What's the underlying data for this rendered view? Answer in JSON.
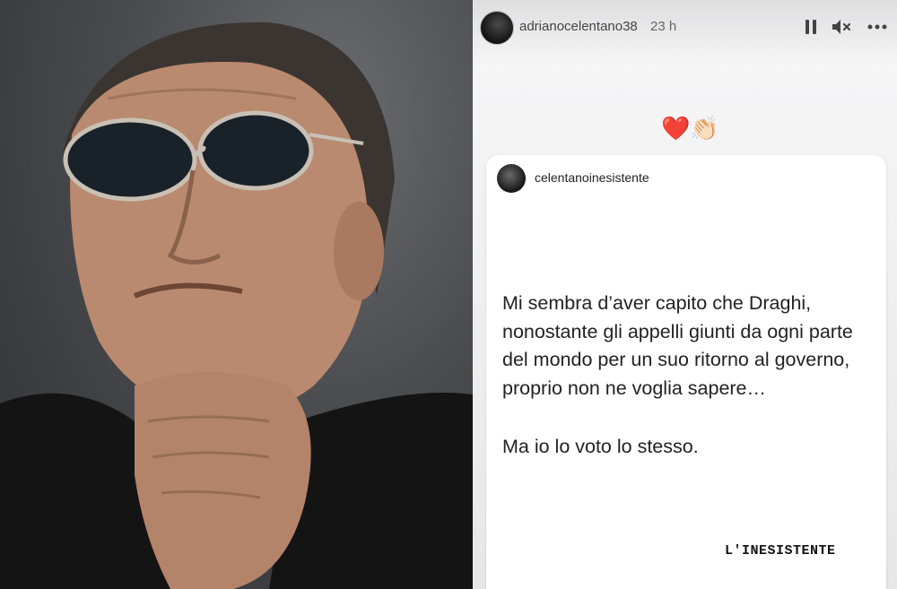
{
  "story": {
    "username": "adrianocelentano38",
    "time": "23 h",
    "controls": {
      "pause_icon": "pause-icon",
      "mute_icon": "muted-speaker-icon",
      "more_icon": "more-options-icon"
    },
    "sticker": "❤️👏🏻"
  },
  "shared_post": {
    "username": "celentanoinesistente",
    "text_line1": "Mi sembra d’aver capito che Draghi, nonostante gli appelli giunti da ogni parte del mondo per un suo ritorno al governo, proprio non ne voglia sapere…",
    "text_line2": "Ma io lo voto lo stesso.",
    "brand": "L'INESISTENTE"
  },
  "colors": {
    "story_bg": "#eeeeef",
    "card_bg": "#ffffff",
    "text": "#222222"
  }
}
